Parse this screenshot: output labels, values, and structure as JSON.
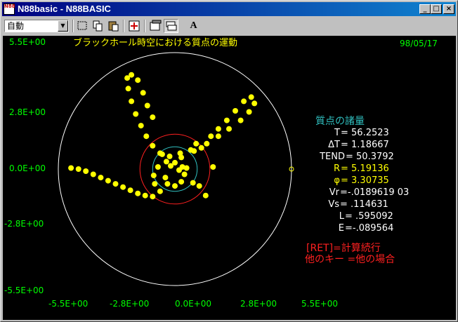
{
  "window": {
    "title": "N88basic - N88BASIC",
    "icon_text": "N88",
    "buttons": {
      "minimize": "_",
      "maximize": "□",
      "close": "×"
    }
  },
  "toolbar": {
    "mode_value": "自動",
    "font_button": "A",
    "icons": [
      "mark-icon",
      "copy-icon",
      "paste-icon",
      "move-icon",
      "properties-icon",
      "window-icon",
      "font-icon"
    ]
  },
  "screen": {
    "title": "ブラックホール時空における質点の運動",
    "date": "98/05/17",
    "y_tick_labels": [
      "5.5E+00",
      "2.8E+00",
      "0.0E+00",
      "-2.8E+00",
      "-5.5E+00"
    ],
    "x_tick_labels": [
      "-5.5E+00",
      "-2.8E+00",
      "0.0E+00",
      "2.8E+00",
      "5.5E+00"
    ],
    "panel_title": "質点の諸量",
    "quantities": [
      {
        "label": "T",
        "value": "= 56.2523"
      },
      {
        "label": "ΔT",
        "value": "= 1.18667"
      },
      {
        "label": "TEND",
        "value": "= 50.3792"
      },
      {
        "label": "R",
        "value": "= 5.19136"
      },
      {
        "label": "φ",
        "value": "= 3.30735"
      },
      {
        "label": "Vr",
        "value": "=-.0189619 03"
      },
      {
        "label": "Vs",
        "value": "= .114631"
      },
      {
        "label": "L",
        "value": "= .595092"
      },
      {
        "label": "E",
        "value": "=-.089564"
      }
    ],
    "instruction_1": "[RET]=計算続行",
    "instruction_2": "他のキー =他の場合"
  },
  "chart_data": {
    "type": "scatter",
    "xlim": [
      -5.5,
      5.5
    ],
    "ylim": [
      -5.5,
      5.5
    ],
    "circles": [
      {
        "r": 5.5,
        "color": "#ffffff"
      },
      {
        "r": 1.65,
        "color": "#ff2020"
      },
      {
        "r": 1.05,
        "color": "#30c0c0"
      }
    ],
    "point_color": "#ffff00",
    "trajectory": [
      [
        -4.9,
        0.05
      ],
      [
        -4.55,
        0.0
      ],
      [
        -4.2,
        -0.1
      ],
      [
        -3.85,
        -0.25
      ],
      [
        -3.5,
        -0.4
      ],
      [
        -3.15,
        -0.55
      ],
      [
        -2.8,
        -0.7
      ],
      [
        -2.45,
        -0.85
      ],
      [
        -2.1,
        -1.0
      ],
      [
        -1.75,
        -1.15
      ],
      [
        -1.4,
        -1.25
      ],
      [
        -1.05,
        -1.3
      ],
      [
        -0.7,
        -1.05
      ],
      [
        -0.95,
        -0.7
      ],
      [
        -1.0,
        -0.3
      ],
      [
        -0.8,
        0.1
      ],
      [
        -0.4,
        0.35
      ],
      [
        0.0,
        0.3
      ],
      [
        0.35,
        0.1
      ],
      [
        0.45,
        -0.25
      ],
      [
        0.3,
        -0.6
      ],
      [
        0.0,
        -0.8
      ],
      [
        -0.35,
        -0.7
      ],
      [
        -0.45,
        -0.4
      ],
      [
        -0.2,
        0.15
      ],
      [
        0.3,
        0.55
      ],
      [
        0.9,
        0.85
      ],
      [
        1.5,
        1.2
      ],
      [
        2.05,
        1.55
      ],
      [
        2.55,
        1.9
      ],
      [
        3.1,
        2.3
      ],
      [
        3.5,
        2.7
      ],
      [
        3.75,
        3.1
      ],
      [
        3.6,
        3.4
      ],
      [
        3.25,
        3.2
      ],
      [
        2.85,
        2.75
      ],
      [
        2.45,
        2.3
      ],
      [
        2.05,
        1.9
      ],
      [
        1.7,
        1.55
      ],
      [
        1.25,
        1.0
      ],
      [
        0.75,
        0.9
      ],
      [
        0.25,
        0.75
      ],
      [
        -0.25,
        0.6
      ],
      [
        -0.7,
        0.75
      ],
      [
        -1.05,
        1.1
      ],
      [
        -1.35,
        1.55
      ],
      [
        -1.6,
        2.05
      ],
      [
        -1.85,
        2.6
      ],
      [
        -2.05,
        3.2
      ],
      [
        -2.2,
        3.8
      ],
      [
        -2.25,
        4.3
      ],
      [
        -2.05,
        4.45
      ],
      [
        -1.75,
        4.2
      ],
      [
        -1.5,
        3.6
      ],
      [
        -1.3,
        3.0
      ],
      [
        -1.05,
        2.45
      ],
      [
        1.0,
        1.2
      ],
      [
        0.55,
        0.05
      ],
      [
        0.2,
        -0.05
      ],
      [
        1.8,
        0.1
      ],
      [
        1.45,
        -1.25
      ],
      [
        0.85,
        -0.65
      ],
      [
        -0.6,
        0.7
      ],
      [
        1.15,
        -0.8
      ]
    ]
  }
}
